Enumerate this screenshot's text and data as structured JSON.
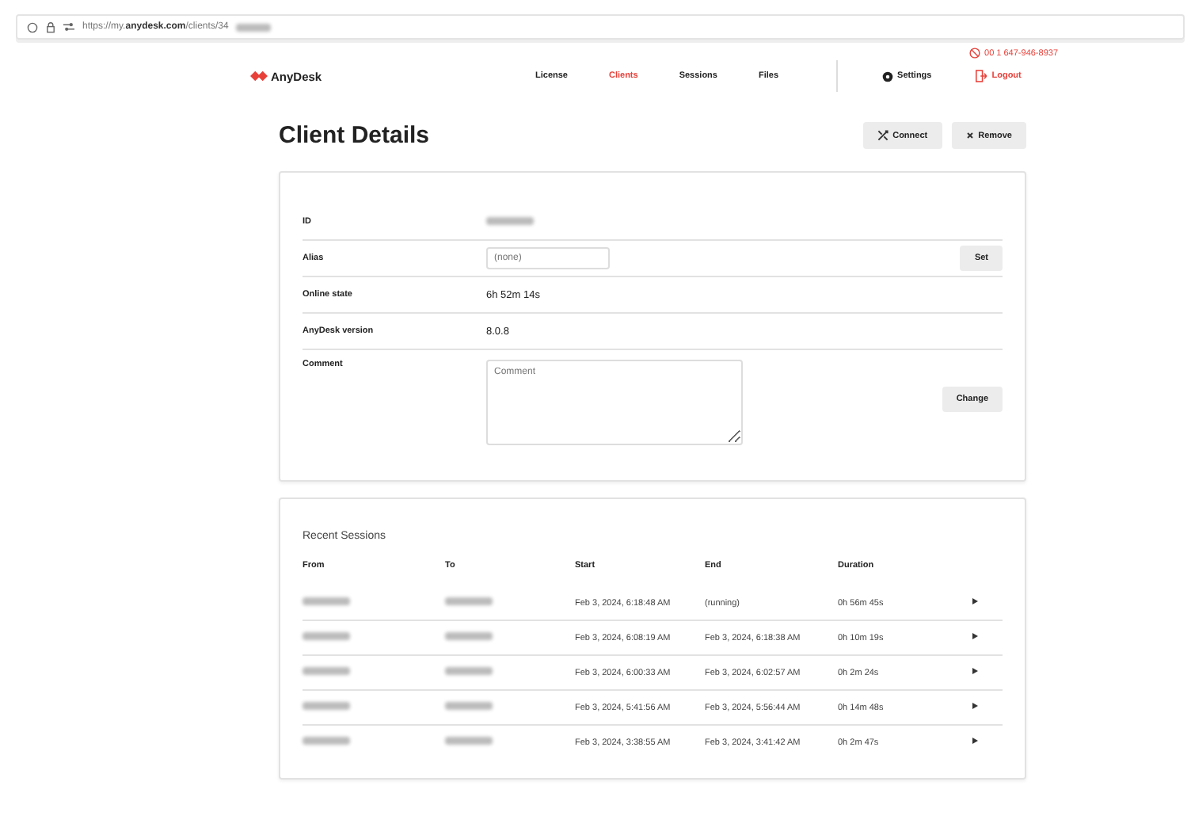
{
  "browser": {
    "url_prefix": "https://my.",
    "url_domain": "anydesk.com",
    "url_path": "/clients/34"
  },
  "header": {
    "phone": "00 1 647-946-8937",
    "logo": "AnyDesk",
    "nav": [
      {
        "label": "License",
        "selected": false
      },
      {
        "label": "Clients",
        "selected": true
      },
      {
        "label": "Sessions",
        "selected": false
      },
      {
        "label": "Files",
        "selected": false
      }
    ],
    "settings": "Settings",
    "logout": "Logout"
  },
  "page": {
    "title": "Client Details",
    "buttons": [
      {
        "label": "Connect",
        "kind": "connect"
      },
      {
        "label": "Remove",
        "kind": "remove"
      }
    ]
  },
  "details": [
    {
      "label": "ID",
      "kind": "redacted"
    },
    {
      "label": "Alias",
      "kind": "input",
      "placeholder": "(none)",
      "button": "Set"
    },
    {
      "label": "Online state",
      "kind": "text",
      "value": "6h 52m 14s"
    },
    {
      "label": "AnyDesk version",
      "kind": "text",
      "value": "8.0.8"
    },
    {
      "label": "Comment",
      "kind": "textarea",
      "placeholder": "Comment",
      "button": "Change"
    }
  ],
  "sessions": {
    "title": "Recent Sessions",
    "columns": [
      "From",
      "To",
      "Start",
      "End",
      "Duration"
    ],
    "rows": [
      {
        "start": "Feb 3, 2024, 6:18:48 AM",
        "end": "(running)",
        "duration": "0h 56m 45s"
      },
      {
        "start": "Feb 3, 2024, 6:08:19 AM",
        "end": "Feb 3, 2024, 6:18:38 AM",
        "duration": "0h 10m 19s"
      },
      {
        "start": "Feb 3, 2024, 6:00:33 AM",
        "end": "Feb 3, 2024, 6:02:57 AM",
        "duration": "0h 2m 24s"
      },
      {
        "start": "Feb 3, 2024, 5:41:56 AM",
        "end": "Feb 3, 2024, 5:56:44 AM",
        "duration": "0h 14m 48s"
      },
      {
        "start": "Feb 3, 2024, 3:38:55 AM",
        "end": "Feb 3, 2024, 3:41:42 AM",
        "duration": "0h 2m 47s"
      }
    ]
  }
}
